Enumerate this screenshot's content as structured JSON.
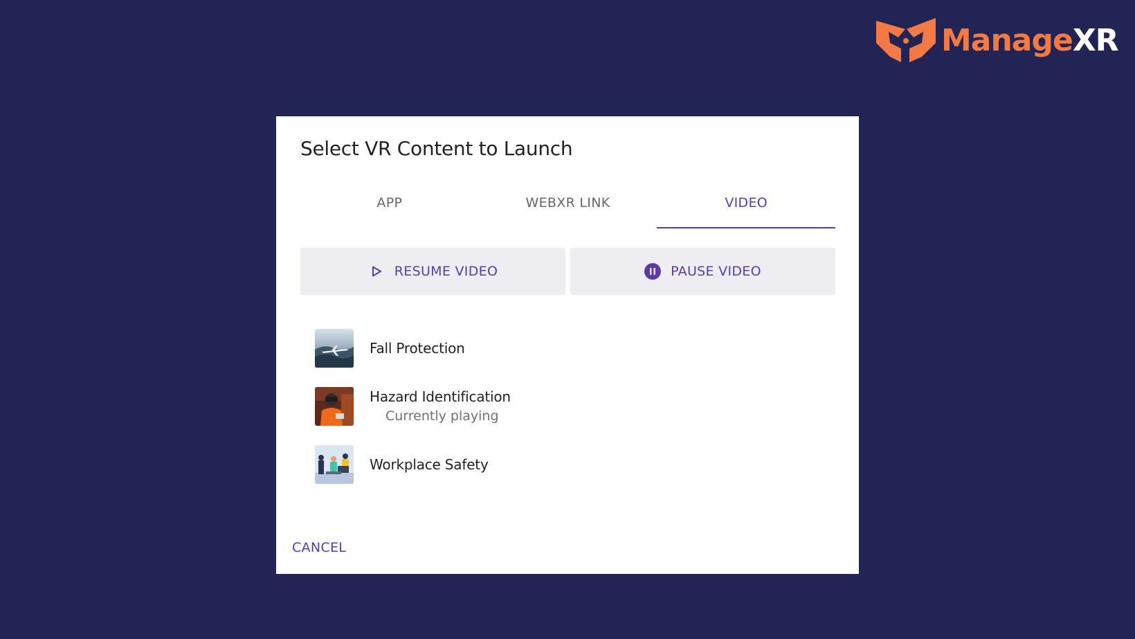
{
  "brand": {
    "name_part1": "Manage",
    "name_part2": "XR",
    "color_primary": "#F47A45",
    "color_secondary": "#FFFFFF"
  },
  "page": {
    "background": "#222455"
  },
  "dialog": {
    "title": "Select VR Content to Launch",
    "tabs": [
      {
        "label": "APP",
        "active": false
      },
      {
        "label": "WEBXR LINK",
        "active": false
      },
      {
        "label": "VIDEO",
        "active": true
      }
    ],
    "controls": {
      "resume": {
        "label": "RESUME VIDEO",
        "icon": "play-outline-icon"
      },
      "pause": {
        "label": "PAUSE VIDEO",
        "icon": "pause-circle-icon"
      }
    },
    "videos": [
      {
        "title": "Fall Protection",
        "status": "",
        "thumb": "airplane-thumbnail"
      },
      {
        "title": "Hazard Identification",
        "status": "Currently playing",
        "thumb": "vr-headset-person-thumbnail"
      },
      {
        "title": "Workplace Safety",
        "status": "",
        "thumb": "office-workers-thumbnail"
      }
    ],
    "cancel_label": "CANCEL",
    "accent_color": "#5B3BA8"
  }
}
